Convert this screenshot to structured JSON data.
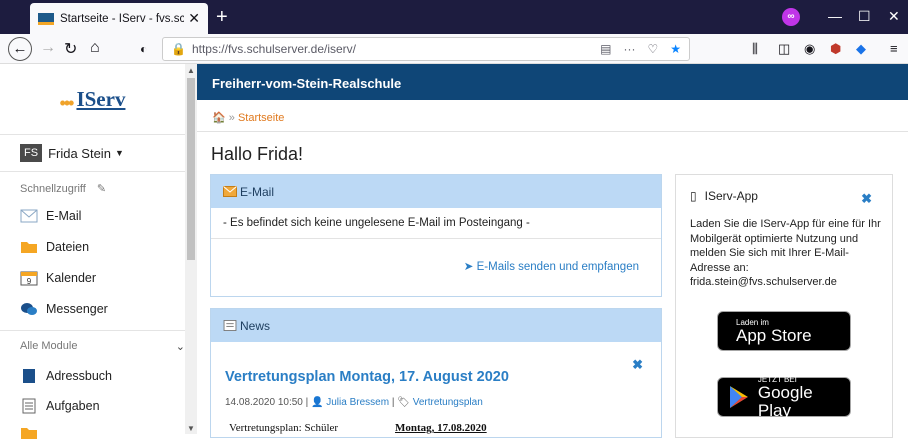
{
  "browser": {
    "tab_title": "Startseite - IServ - fvs.schulserver",
    "url": "https://fvs.schulserver.de/iserv/",
    "private_badge": "∞"
  },
  "sidebar": {
    "logo": "IServ",
    "user_name": "Frida Stein",
    "user_initials": "FS",
    "quick_access": "Schnellzugriff",
    "quick_items": [
      {
        "label": "E-Mail",
        "icon": "mail-icon"
      },
      {
        "label": "Dateien",
        "icon": "folder-icon"
      },
      {
        "label": "Kalender",
        "icon": "calendar-icon"
      },
      {
        "label": "Messenger",
        "icon": "chat-icon"
      }
    ],
    "all_modules": "Alle Module",
    "calendar_day": "9",
    "module_items": [
      {
        "label": "Adressbuch",
        "icon": "addressbook-icon"
      },
      {
        "label": "Aufgaben",
        "icon": "tasks-icon"
      }
    ]
  },
  "header": {
    "school": "Freiherr-vom-Stein-Realschule",
    "breadcrumb": "Startseite"
  },
  "main": {
    "greeting": "Hallo Frida!",
    "email": {
      "title": "E-Mail",
      "body": "- Es befindet sich keine ungelesene E-Mail im Posteingang -",
      "link": "E-Mails senden und empfangen"
    },
    "news": {
      "title": "News",
      "item_title": "Vertretungsplan Montag, 17. August 2020",
      "date": "14.08.2020 10:50",
      "author": "Julia Bressem",
      "category": "Vertretungsplan",
      "preview_label": "Vertretungsplan: Schüler",
      "preview_date": "Montag, 17.08.2020"
    },
    "app": {
      "title": "IServ-App",
      "text": "Laden Sie die IServ-App für eine für Ihr Mobilgerät optimierte Nutzung und melden Sie sich mit Ihrer E-Mail-Adresse an: frida.stein@fvs.schulserver.de",
      "appstore_sub": "Laden im",
      "appstore_main": "App Store",
      "play_sub": "JETZT BEI",
      "play_main": "Google Play"
    }
  }
}
